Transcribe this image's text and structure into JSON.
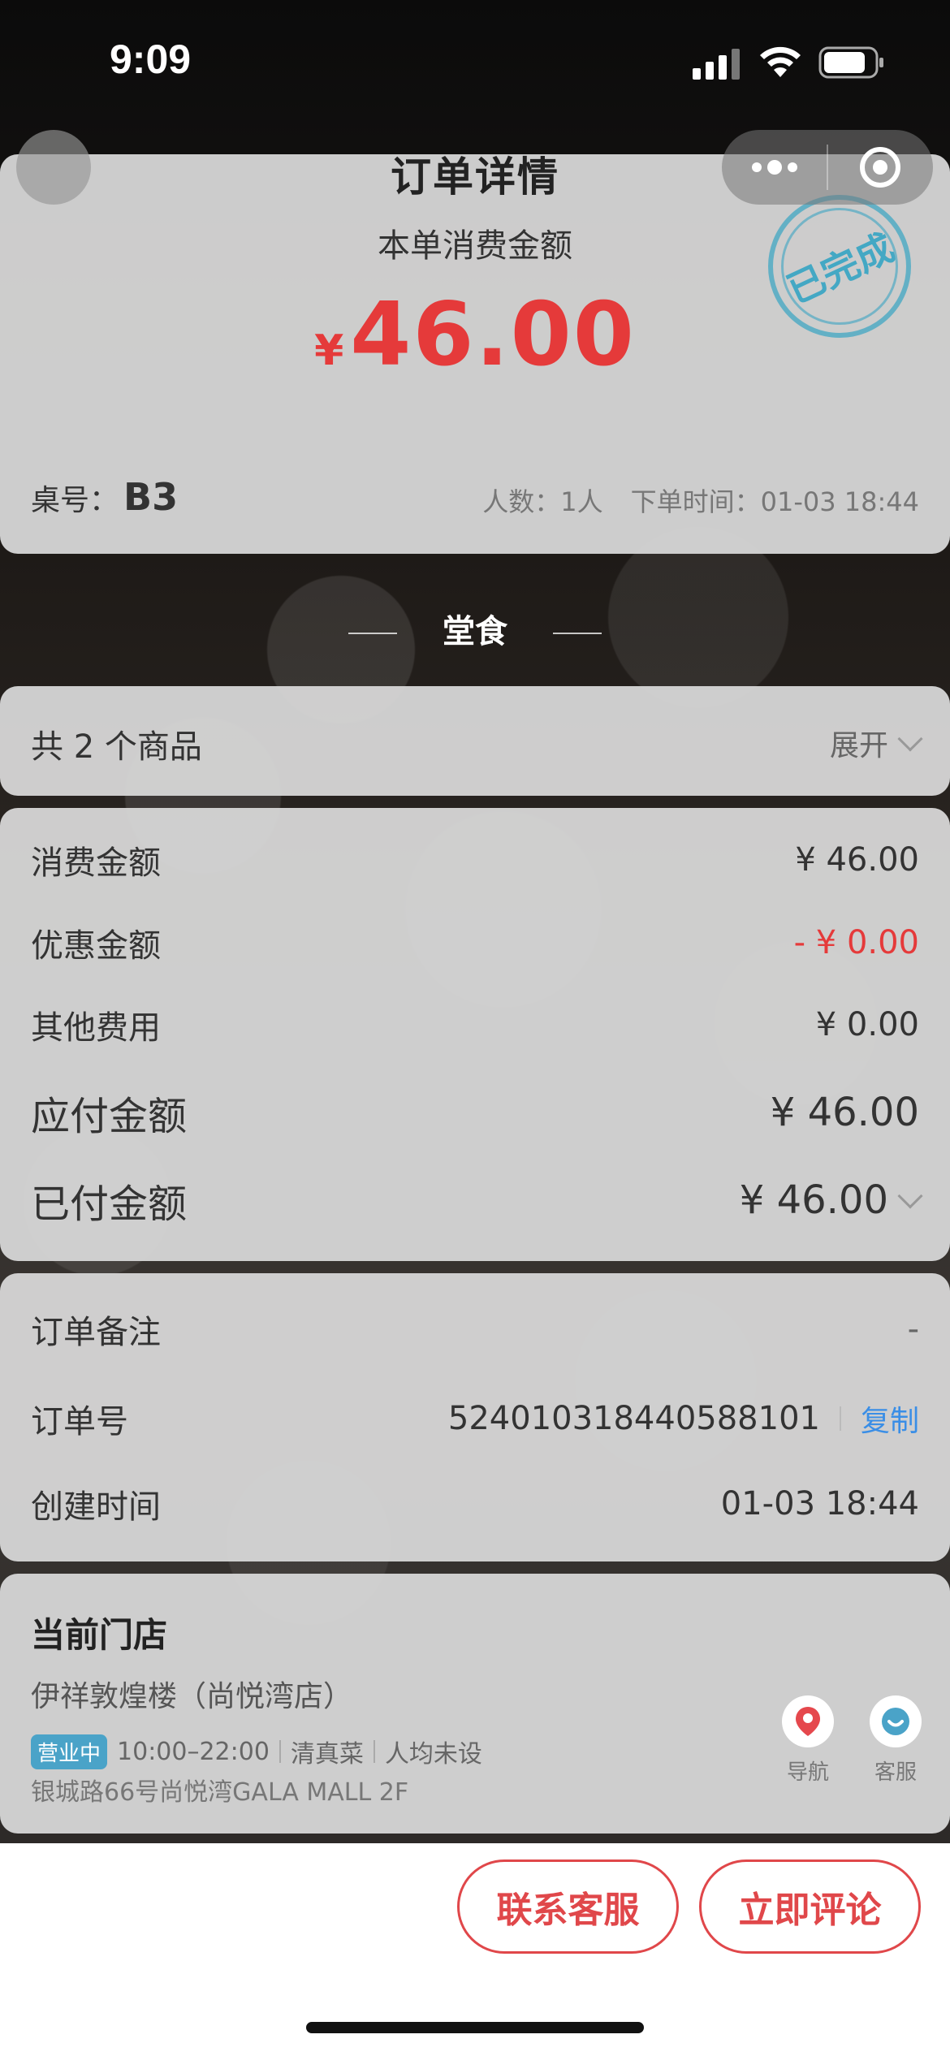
{
  "status_bar": {
    "time": "9:09"
  },
  "header": {
    "title": "订单详情"
  },
  "summary": {
    "caption": "本单消费金额",
    "currency": "¥",
    "amount": "46.00",
    "stamp": "已完成",
    "table_label": "桌号：",
    "table_value": "B3",
    "people": "人数：1人",
    "order_time": "下单时间：01-03 18:44"
  },
  "section": {
    "title": "堂食"
  },
  "goods": {
    "count_label": "共 2 个商品",
    "expand_label": "展开"
  },
  "fees": {
    "rows": [
      {
        "label": "消费金额",
        "value": "¥ 46.00"
      },
      {
        "label": "优惠金额",
        "value": "- ¥ 0.00"
      },
      {
        "label": "其他费用",
        "value": "¥ 0.00"
      },
      {
        "label": "应付金额",
        "value": "¥ 46.00"
      },
      {
        "label": "已付金额",
        "value": "¥ 46.00"
      }
    ]
  },
  "info": {
    "remark_label": "订单备注",
    "remark_value": "-",
    "order_no_label": "订单号",
    "order_no_value": "524010318440588101",
    "copy_label": "复制",
    "created_label": "创建时间",
    "created_value": "01-03 18:44"
  },
  "store": {
    "heading": "当前门店",
    "name": "伊祥敦煌楼（尚悦湾店）",
    "status_badge": "营业中",
    "hours": "10:00–22:00",
    "cuisine": "清真菜",
    "avg_price": "人均未设",
    "address": "银城路66号尚悦湾GALA MALL 2F",
    "nav_label": "导航",
    "service_label": "客服"
  },
  "actions": {
    "contact": "联系客服",
    "review": "立即评论"
  },
  "colors": {
    "accent_red": "#e53a3a",
    "link_blue": "#3a8ee6",
    "stamp_blue": "#4aa3c8"
  }
}
